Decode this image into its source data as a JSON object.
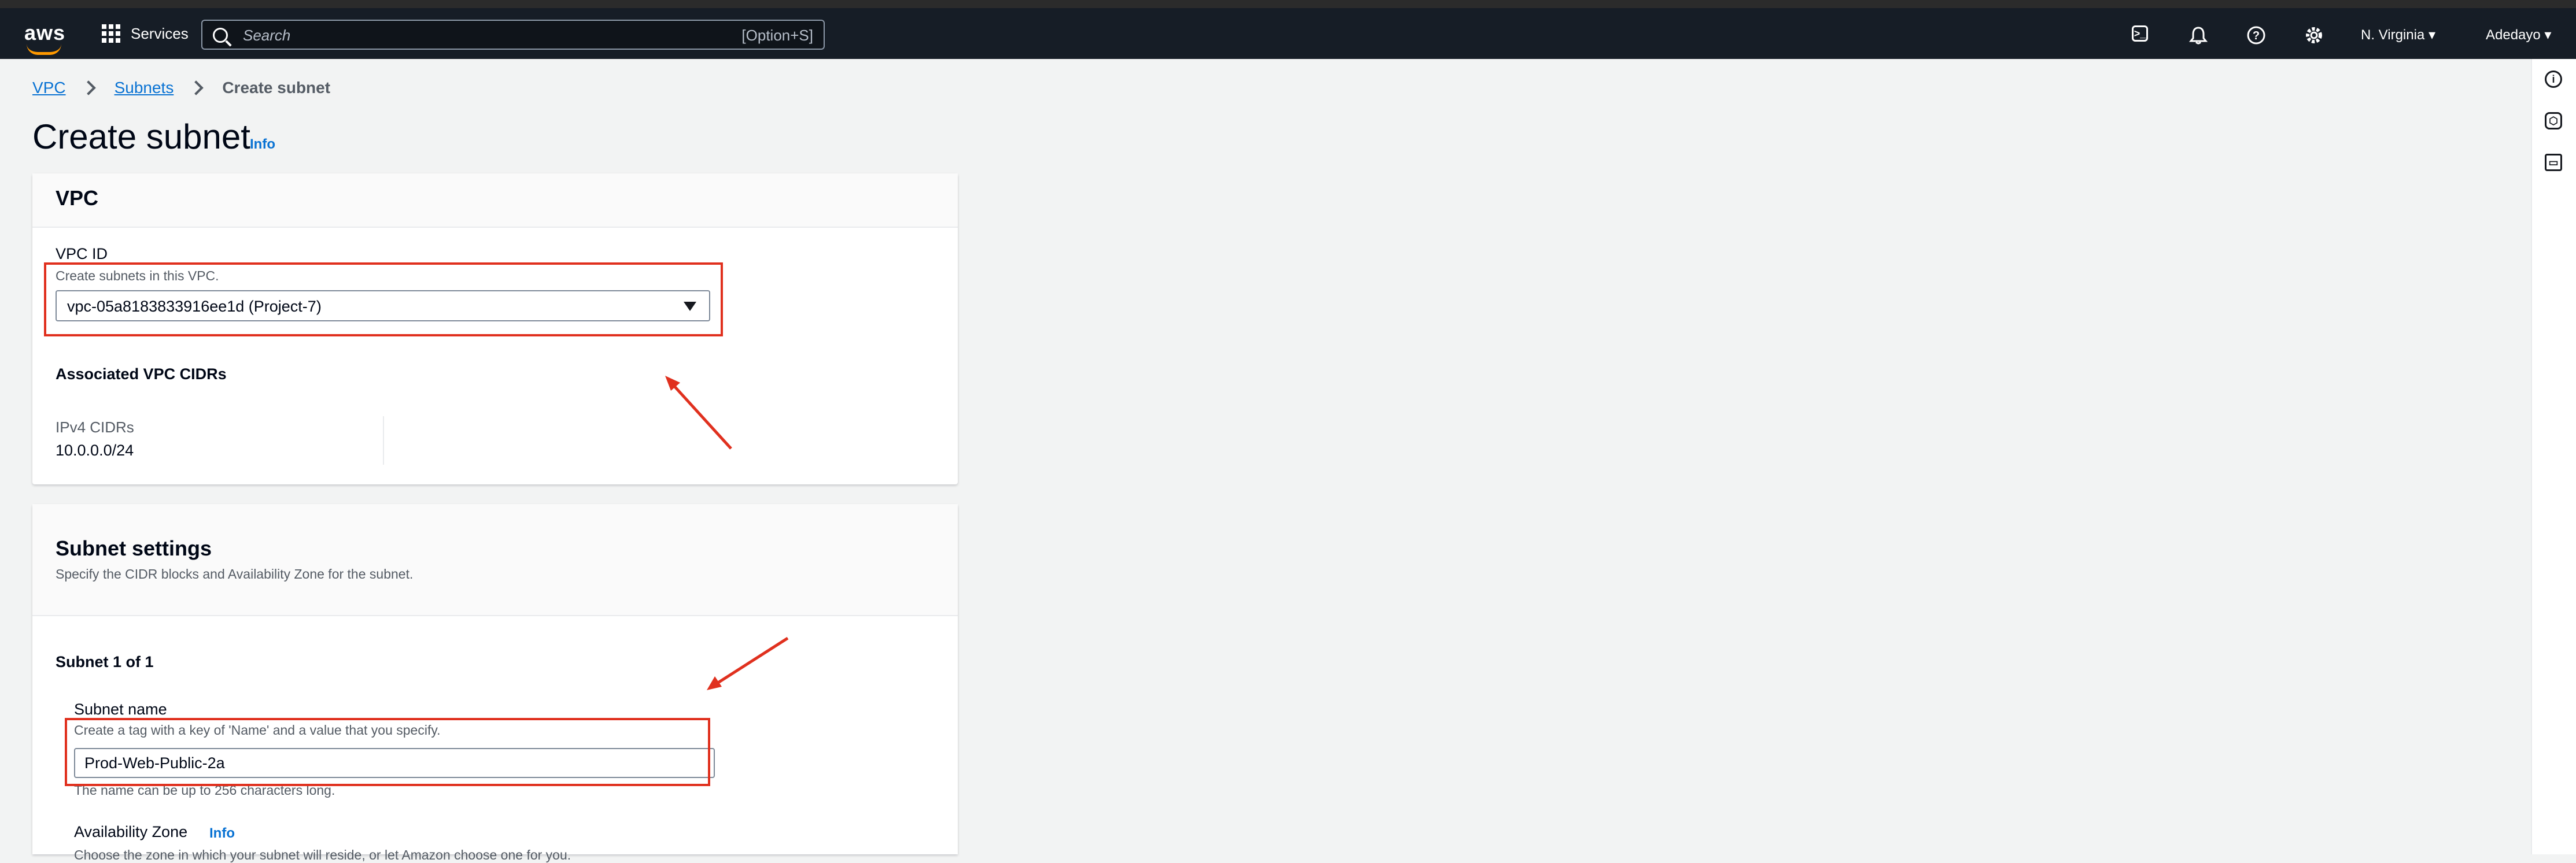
{
  "header": {
    "logo": "aws",
    "services_label": "Services",
    "search_placeholder": "Search",
    "search_shortcut": "[Option+S]",
    "region": "N. Virginia ▾",
    "user": "Adedayo ▾",
    "icons": [
      "cloudshell-icon",
      "bell-icon",
      "help-icon",
      "gear-icon"
    ]
  },
  "breadcrumb": {
    "vpc": "VPC",
    "subnets": "Subnets",
    "current": "Create subnet"
  },
  "page": {
    "title": "Create subnet",
    "info": "Info"
  },
  "vpc_panel": {
    "title": "VPC",
    "vpc_id_label": "VPC ID",
    "vpc_id_desc": "Create subnets in this VPC.",
    "vpc_id_value": "vpc-05a8183833916ee1d (Project-7)",
    "cidrs_title": "Associated VPC CIDRs",
    "ipv4_label": "IPv4 CIDRs",
    "ipv4_value": "10.0.0.0/24"
  },
  "subnet_panel": {
    "title": "Subnet settings",
    "desc": "Specify the CIDR blocks and Availability Zone for the subnet.",
    "subnet_count": "Subnet 1 of 1",
    "name_label": "Subnet name",
    "name_desc": "Create a tag with a key of 'Name' and a value that you specify.",
    "name_value": "Prod-Web-Public-2a",
    "name_constraint": "The name can be up to 256 characters long.",
    "az_label": "Availability Zone",
    "az_info": "Info",
    "az_desc": "Choose the zone in which your subnet will reside, or let Amazon choose one for you."
  },
  "colors": {
    "header_bg": "#161d26",
    "link": "#0972d3",
    "annotation": "#e0301e"
  }
}
